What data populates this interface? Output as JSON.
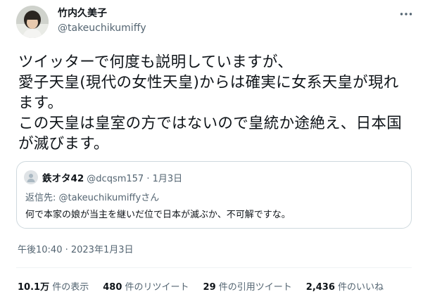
{
  "author": {
    "display_name": "竹内久美子",
    "handle": "@takeuchikumiffy"
  },
  "tweet": {
    "text": "ツイッターで何度も説明していますが、\n愛子天皇(現代の女性天皇)からは確実に女系天皇が現れます。\nこの天皇は皇室の方ではないので皇統か途絶え、日本国が滅びます。",
    "timestamp": "午後10:40 · 2023年1月3日"
  },
  "quote": {
    "display_name": "鉄オタ42",
    "handle_date": "@dcqsm157 · 1月3日",
    "reply_prefix": "返信先:",
    "reply_mention": "@takeuchikumiffyさん",
    "text": "何で本家の娘が当主を継いだ位で日本が滅ぶか、不可解ですな。"
  },
  "stats": [
    {
      "count": "10.1万",
      "label": "件の表示"
    },
    {
      "count": "480",
      "label": "件のリツイート"
    },
    {
      "count": "29",
      "label": "件の引用ツイート"
    },
    {
      "count": "2,436",
      "label": "件のいいね"
    }
  ],
  "icons": {
    "more": "more-horizontal-icon",
    "quote_avatar": "default-avatar-icon"
  }
}
